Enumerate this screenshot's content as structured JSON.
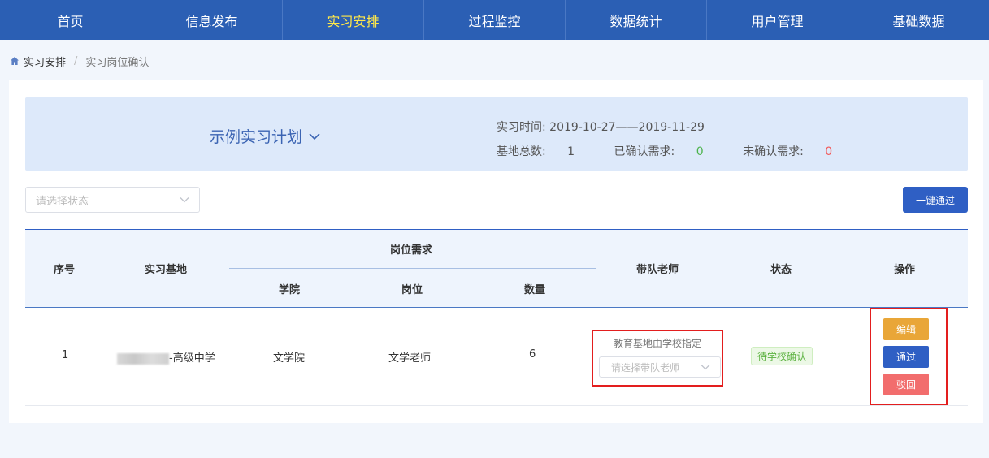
{
  "nav": {
    "items": [
      {
        "label": "首页"
      },
      {
        "label": "信息发布"
      },
      {
        "label": "实习安排"
      },
      {
        "label": "过程监控"
      },
      {
        "label": "数据统计"
      },
      {
        "label": "用户管理"
      },
      {
        "label": "基础数据"
      }
    ],
    "active_index": 2
  },
  "breadcrumb": {
    "home_icon": "home-icon",
    "item1": "实习安排",
    "separator": "/",
    "item2": "实习岗位确认"
  },
  "plan": {
    "title": "示例实习计划",
    "time_label": "实习时间: ",
    "time_value": "2019-10-27——2019-11-29",
    "base_total_label": "基地总数: ",
    "base_total_value": "1",
    "confirmed_label": "已确认需求: ",
    "confirmed_value": "0",
    "unconfirmed_label": "未确认需求: ",
    "unconfirmed_value": "0"
  },
  "filters": {
    "status_placeholder": "请选择状态",
    "approve_all_label": "一键通过"
  },
  "table": {
    "headers": {
      "index": "序号",
      "base": "实习基地",
      "demand": "岗位需求",
      "college": "学院",
      "post": "岗位",
      "count": "数量",
      "teacher": "带队老师",
      "status": "状态",
      "ops": "操作"
    },
    "rows": [
      {
        "index": "1",
        "base_suffix": "-高级中学",
        "college": "文学院",
        "post": "文学老师",
        "count": "6",
        "teacher_note": "教育基地由学校指定",
        "teacher_placeholder": "请选择带队老师",
        "status": "待学校确认",
        "edit_label": "编辑",
        "pass_label": "通过",
        "reject_label": "驳回"
      }
    ]
  },
  "colors": {
    "nav_bg": "#2b5fb4",
    "nav_active": "#ffe84a",
    "primary": "#2f5fc4",
    "warning": "#e9a638",
    "danger": "#f26d6d",
    "success": "#4bb34b",
    "highlight_box": "#e31e1e"
  }
}
